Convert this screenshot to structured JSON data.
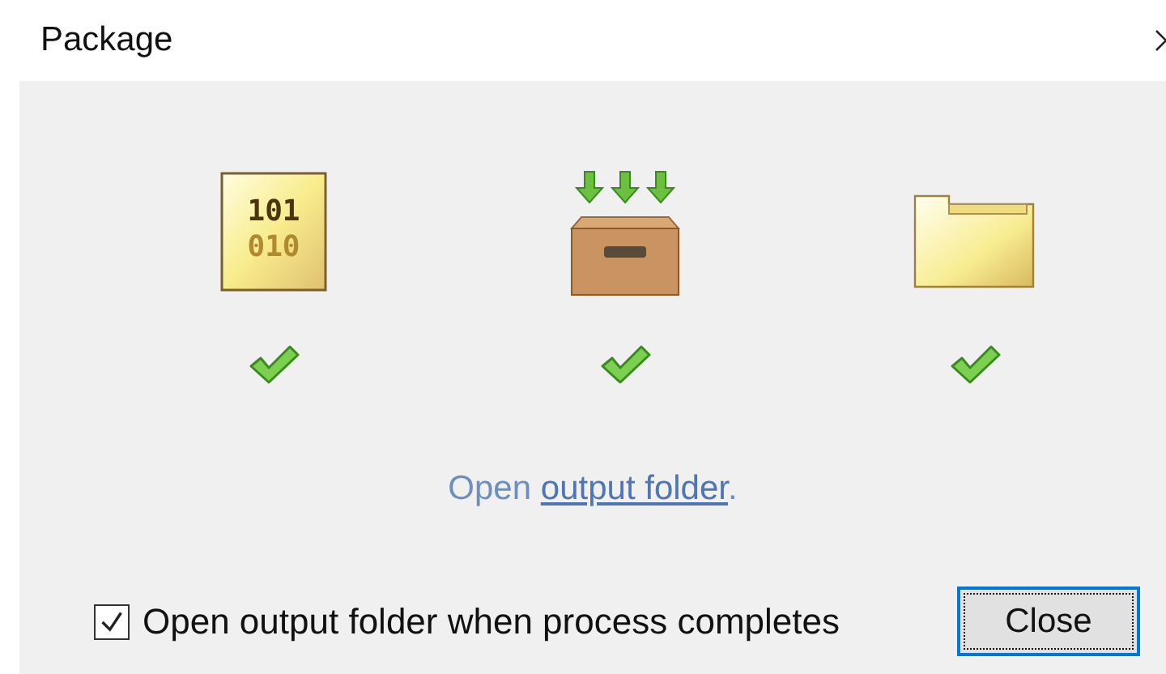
{
  "window": {
    "title": "Package"
  },
  "steps": [
    {
      "kind": "binary",
      "lines": [
        "101",
        "010"
      ],
      "done": true
    },
    {
      "kind": "box",
      "done": true
    },
    {
      "kind": "folder",
      "done": true
    }
  ],
  "result": {
    "prefix": "Open ",
    "link": "output folder",
    "suffix": "."
  },
  "option": {
    "label": "Open output folder when process completes",
    "checked": true
  },
  "buttons": [
    {
      "label": "Close",
      "focused": true
    }
  ]
}
